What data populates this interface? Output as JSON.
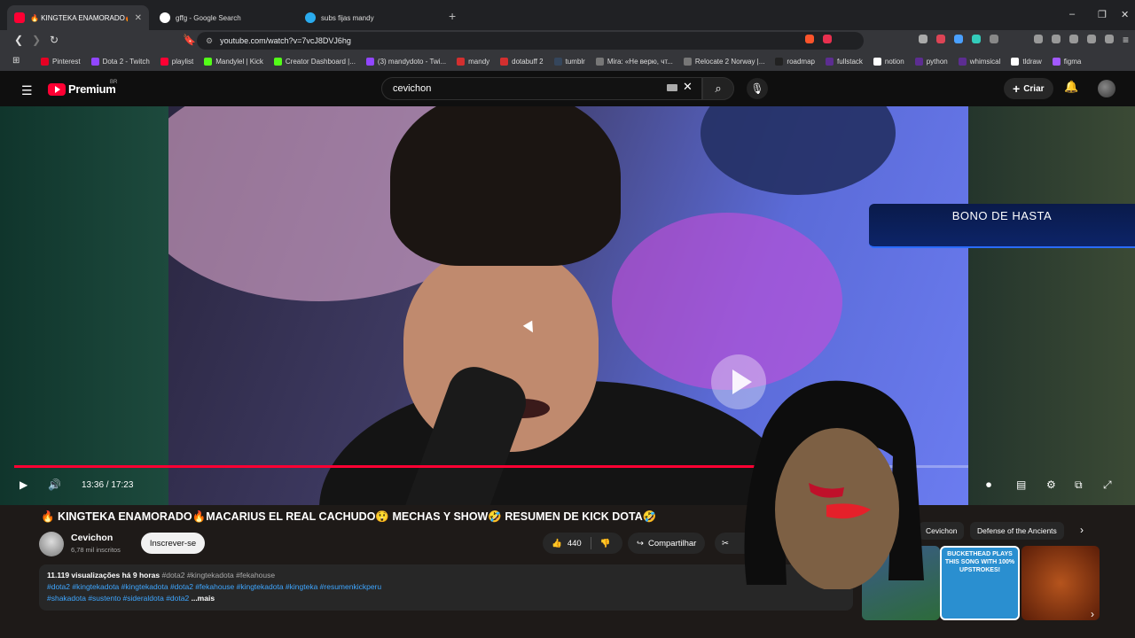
{
  "browser": {
    "tabs": [
      {
        "title": "🔥 KINGTEKA ENAMORADO🔥M",
        "active": true,
        "icon": "youtube-icon"
      },
      {
        "title": "gffg - Google Search",
        "active": false,
        "icon": "google-icon"
      },
      {
        "title": "subs fijas mandy",
        "active": false,
        "icon": "telegram-icon"
      }
    ],
    "new_tab": "+",
    "url": "youtube.com/watch?v=7vcJ8DVJ6hg",
    "bookmarks": [
      {
        "label": "Pinterest",
        "color": "#e60023"
      },
      {
        "label": "Dota 2 - Twitch",
        "color": "#9146ff"
      },
      {
        "label": "playlist",
        "color": "#ff0033"
      },
      {
        "label": "Mandylel | Kick",
        "color": "#53fc18"
      },
      {
        "label": "Creator Dashboard |...",
        "color": "#53fc18"
      },
      {
        "label": "(3) mandydoto - Twi...",
        "color": "#9146ff"
      },
      {
        "label": "mandy",
        "color": "#d32f2f"
      },
      {
        "label": "dotabuff 2",
        "color": "#d32f2f"
      },
      {
        "label": "tumblr",
        "color": "#35465c"
      },
      {
        "label": "Mira: «Не верю, чт...",
        "color": "#777777"
      },
      {
        "label": "Relocate 2 Norway |...",
        "color": "#777777"
      },
      {
        "label": "roadmap",
        "color": "#222222"
      },
      {
        "label": "fullstack",
        "color": "#5c2d91"
      },
      {
        "label": "notion",
        "color": "#ffffff"
      },
      {
        "label": "python",
        "color": "#5c2d91"
      },
      {
        "label": "whimsical",
        "color": "#5c2d91"
      },
      {
        "label": "tldraw",
        "color": "#ffffff"
      },
      {
        "label": "figma",
        "color": "#a259ff"
      }
    ]
  },
  "youtube": {
    "logo_word": "Premium",
    "region": "BR",
    "search_value": "cevichon",
    "create_label": "Criar"
  },
  "player": {
    "time": "13:36 / 17:23",
    "progress": 0.7823,
    "ad_text": "BONO DE HASTA"
  },
  "video": {
    "title": "🔥 KINGTEKA ENAMORADO🔥MACARIUS EL REAL CACHUDO😲 MECHAS Y SHOW🤣 RESUMEN DE KICK DOTA🤣",
    "channel": "Cevichon",
    "subscribers": "6,78 mil inscritos",
    "subscribe_label": "Inscrever-se",
    "likes": "440",
    "share_label": "Compartilhar",
    "clip_label": "Cli",
    "views_meta": "11.119 visualizações  há 9 horas",
    "desc_line1_tags": "#dota2 #kingtekadota #fekahouse",
    "desc_line2": "#dota2 #kingtekadota #kingtekadota #dota2 #fekahouse #kingtekadota #kingteka  #resumenkickperu",
    "desc_line3": "#shakadota #sustento #sideraldota #dota2",
    "more_label": "...mais"
  },
  "sidebar": {
    "chips": [
      "Cevichon",
      "Defense of the Ancients"
    ],
    "thumb_text": "BUCKETHEAD PLAYS THIS SONG WITH 100% UPSTROKES!"
  },
  "colors": {
    "accent": "#ff0033",
    "link": "#3ea6ff",
    "surface": "#272727"
  }
}
